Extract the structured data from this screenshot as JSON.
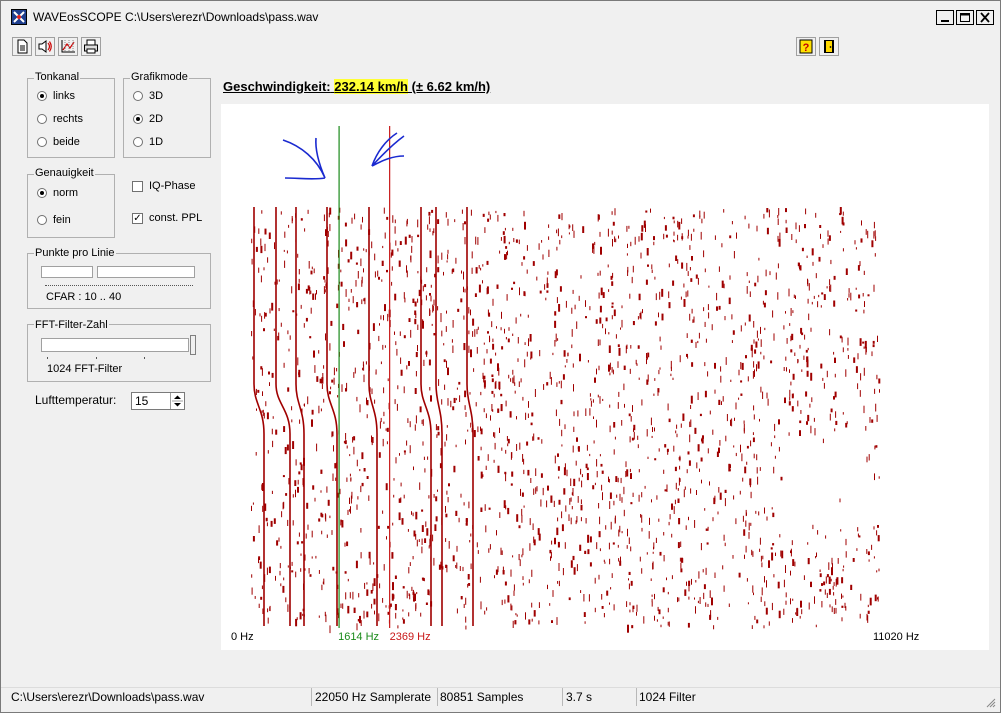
{
  "window": {
    "title": "WAVEosSCOPE  C:\\Users\\erezr\\Downloads\\pass.wav"
  },
  "toolbar": {
    "icons": [
      "new-document-icon",
      "speaker-icon",
      "chart-settings-icon",
      "print-icon",
      "help-icon",
      "exit-door-icon"
    ]
  },
  "tonkanal": {
    "label": "Tonkanal",
    "options": [
      "links",
      "rechts",
      "beide"
    ],
    "selected": "links"
  },
  "grafikmode": {
    "label": "Grafikmode",
    "options": [
      "3D",
      "2D",
      "1D"
    ],
    "selected": "2D"
  },
  "genauigkeit": {
    "label": "Genauigkeit",
    "options": [
      "norm",
      "fein"
    ],
    "selected": "norm"
  },
  "iq_phase": {
    "label": "IQ-Phase",
    "checked": false
  },
  "const_ppl": {
    "label": "const. PPL",
    "checked": true
  },
  "punkte": {
    "label": "Punkte pro Linie",
    "value_text": "CFAR : 10 .. 40"
  },
  "fft": {
    "label": "FFT-Filter-Zahl",
    "value_text": "1024 FFT-Filter"
  },
  "lufttemp": {
    "label": "Lufttemperatur:",
    "value": "15"
  },
  "speed": {
    "prefix": "Geschwindigkeit:",
    "value": "232.14 km/h",
    "suffix": " (± 6.62 km/h)"
  },
  "spectrogram": {
    "axis_min_label": "0 Hz",
    "axis_max_label": "11020 Hz",
    "freq_max_hz": 11020,
    "marker_green_label": "1614 Hz",
    "marker_green_hz": 1614,
    "marker_red_label": "2369 Hz",
    "marker_red_hz": 2369,
    "colors": {
      "data": "#a00000",
      "green_marker": "#1a8a1a",
      "red_marker": "#c81818",
      "arrows": "#1a2ad0"
    }
  },
  "status": {
    "path": "C:\\Users\\erezr\\Downloads\\pass.wav",
    "samplerate": "22050 Hz Samplerate",
    "samples": "80851 Samples",
    "duration": "3.7 s",
    "filter": "1024 Filter"
  }
}
